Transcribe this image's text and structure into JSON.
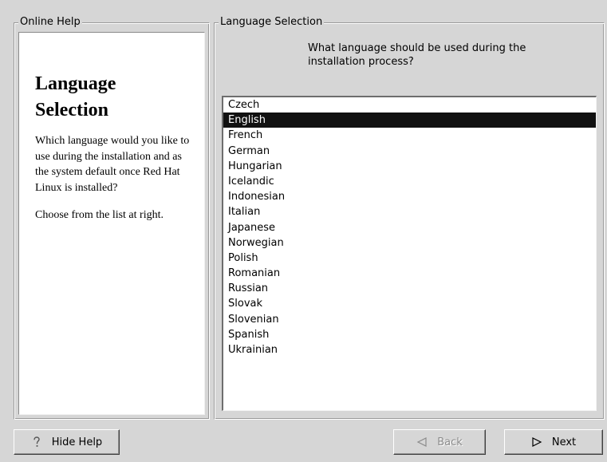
{
  "help": {
    "legend": "Online Help",
    "title": "Language Selection",
    "paragraphs": [
      "Which language would you like to use during the installation and as the system default once Red Hat Linux is installed?",
      "Choose from the list at right."
    ]
  },
  "language_panel": {
    "legend": "Language Selection",
    "question": "What language should be used during the installation process?",
    "languages": [
      "Czech",
      "English",
      "French",
      "German",
      "Hungarian",
      "Icelandic",
      "Indonesian",
      "Italian",
      "Japanese",
      "Norwegian",
      "Polish",
      "Romanian",
      "Russian",
      "Slovak",
      "Slovenian",
      "Spanish",
      "Ukrainian"
    ],
    "selected": "English"
  },
  "buttons": {
    "hide_help": {
      "label": "Hide Help",
      "icon": "question-mark-icon"
    },
    "back": {
      "label": "Back",
      "icon": "back-arrow-icon",
      "enabled": false
    },
    "next": {
      "label": "Next",
      "icon": "next-arrow-icon",
      "enabled": true
    }
  }
}
